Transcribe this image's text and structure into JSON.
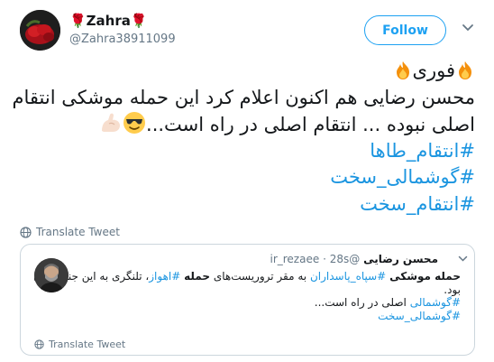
{
  "header": {
    "display_name": "🌹Zahra🌹",
    "handle": "@Zahra38911099",
    "follow_label": "Follow"
  },
  "tweet": {
    "fawri": "فوری",
    "line2": "محسن رضایی هم اکنون اعلام کرد این حمله موشکی انتقام",
    "line3": "اصلی نبوده ... انتقام اصلی در راه است...",
    "hashtags": [
      "#انتقام_طاها",
      "#گوشمالی_سخت",
      "#انتقام_سخت"
    ]
  },
  "translate_label": "Translate Tweet",
  "quote": {
    "name": "محسن رضایی",
    "handle": "@ir_rezaee",
    "separator": "·",
    "time": "28s",
    "line1_bold": "حمله موشکی",
    "line1_tag": "#سپاه_پاسداران",
    "line1_mid": "به مقر تروریست‌های",
    "line1_bold2": "حمله",
    "line1_tag2": "#اهواز",
    "line1_end": "، تلنگری به این جنایتکاران",
    "line2": "بود.",
    "line3_tag": "#گوشمالی",
    "line3_text": "اصلی در راه است...",
    "line4_tag": "#گوشمالی_سخت",
    "translate_label": "Translate Tweet"
  },
  "colors": {
    "link": "#1b95e0",
    "follow": "#1da1f2",
    "muted": "#657786",
    "border": "#ccd6dd"
  },
  "icons": [
    "flower-avatar",
    "caret-down-icon",
    "fire-emoji",
    "sunglasses-emoji",
    "flexed-biceps-emoji",
    "globe-icon"
  ]
}
